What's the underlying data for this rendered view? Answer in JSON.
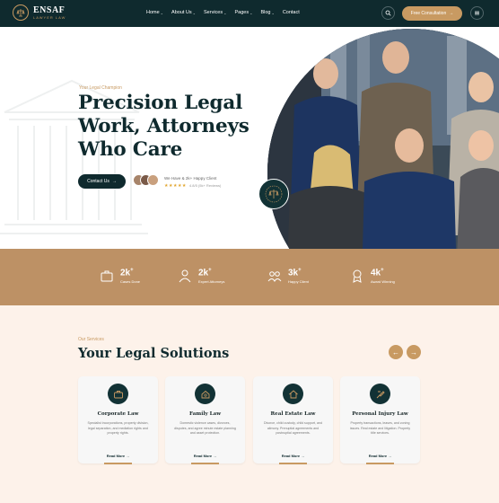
{
  "brand": {
    "name": "ENSAF",
    "tagline": "LAWYER LAW"
  },
  "nav": {
    "items": [
      {
        "label": "Home",
        "has_dropdown": true
      },
      {
        "label": "About Us",
        "has_dropdown": true
      },
      {
        "label": "Services",
        "has_dropdown": true
      },
      {
        "label": "Pages",
        "has_dropdown": true
      },
      {
        "label": "Blog",
        "has_dropdown": true
      },
      {
        "label": "Contact",
        "has_dropdown": false
      }
    ],
    "cta_label": "Free Consultation"
  },
  "hero": {
    "eyebrow": "Your Legal Champion",
    "title": "Precision Legal Work, Attorneys Who Care",
    "contact_button": "Contact Us",
    "client_text": "We Have & 2k+ Happy Client",
    "stars": "★★★★★",
    "reviews": "4.8/5 (5k+ Reviews)"
  },
  "stats": [
    {
      "value": "2k",
      "suffix": "+",
      "label": "Cases Done",
      "icon": "case-icon"
    },
    {
      "value": "2k",
      "suffix": "+",
      "label": "Expert Attorneys",
      "icon": "attorney-icon"
    },
    {
      "value": "3k",
      "suffix": "+",
      "label": "Happy Client",
      "icon": "clients-icon"
    },
    {
      "value": "4k",
      "suffix": "+",
      "label": "Award Winning",
      "icon": "award-icon"
    }
  ],
  "services": {
    "eyebrow": "Our Services",
    "title": "Your Legal Solutions",
    "cards": [
      {
        "title": "Corporate Law",
        "desc": "Specialist incorporations, property division, legal separation, and mediation rights and property rights.",
        "link": "Read More",
        "icon": "briefcase-icon"
      },
      {
        "title": "Family Law",
        "desc": "Domestic violence cases, divorces, disputes, and agree minute estate planning and asset protection.",
        "link": "Read More",
        "icon": "family-icon"
      },
      {
        "title": "Real Estate Law",
        "desc": "Divorce, child custody, child support, and alimony. Prenuptial agreements and postnuptial agreements.",
        "link": "Read More",
        "icon": "house-icon"
      },
      {
        "title": "Personal Injury Law",
        "desc": "Property transactions, leases, and zoning issues. Real estate and litigation. Property title services.",
        "link": "Read More",
        "icon": "injury-icon"
      }
    ]
  },
  "colors": {
    "dark": "#0f2a2e",
    "gold": "#c89a62",
    "tan": "#bd9165",
    "cream": "#fdf2ea"
  }
}
